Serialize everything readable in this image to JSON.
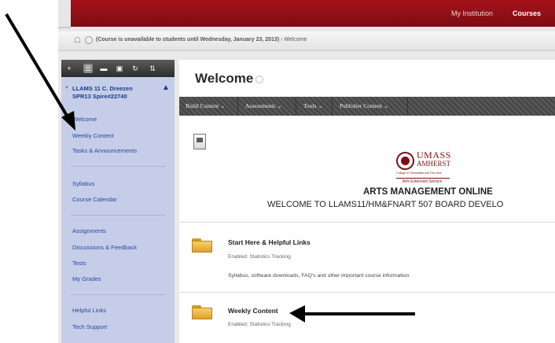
{
  "topnav": {
    "items": [
      {
        "label": "My Institution",
        "active": false
      },
      {
        "label": "Courses",
        "active": true
      }
    ]
  },
  "breadcrumb": {
    "home_icon": "home-icon",
    "notice": "(Course is unavailable to students until Wednesday, January 23, 2013)",
    "separator": "›",
    "current": "Welcome"
  },
  "sidebar": {
    "tool_icons": [
      "plus-icon",
      "list-view-icon",
      "folder-view-icon",
      "card-view-icon",
      "refresh-icon",
      "sort-icon"
    ],
    "course_title_line1": "LLAMS 11 C. Dreezen",
    "course_title_line2": "SPR13 Spire#22740",
    "items": [
      {
        "label": "Welcome"
      },
      {
        "label": "Weekly Content"
      },
      {
        "label": "Tasks & Announcements"
      },
      {
        "label": "Syllabus"
      },
      {
        "label": "Course Calendar"
      },
      {
        "label": "Assignments"
      },
      {
        "label": "Discussions & Feedback"
      },
      {
        "label": "Tests"
      },
      {
        "label": "My Grades"
      },
      {
        "label": "Helpful Links"
      },
      {
        "label": "Tech Support"
      }
    ]
  },
  "page": {
    "title": "Welcome",
    "actions": [
      {
        "label": "Build Content ⌄"
      },
      {
        "label": "Assessments ⌄"
      },
      {
        "label": "Tools ⌄"
      },
      {
        "label": "Publisher Content ⌄"
      }
    ],
    "banner": {
      "logo_name": "UMASS",
      "logo_sub": "AMHERST",
      "logo_fine": "College of Humanities and Fine Arts",
      "logo_ext": "Arts Extension Service",
      "heading": "ARTS MANAGEMENT ONLINE",
      "welcome": "WELCOME TO LLAMS11/HM&FNART 507 BOARD DEVELO"
    },
    "items": [
      {
        "title": "Start Here & Helpful Links",
        "meta": "Enabled:  Statistics Tracking",
        "description": "Syllabus, software downloads, FAQ's and other important course information."
      },
      {
        "title": "Weekly Content",
        "meta": "Enabled:  Statistics Tracking",
        "description": ""
      }
    ]
  },
  "colors": {
    "brand_red": "#8f1019",
    "sidebar_bg": "#c5cde8",
    "link_blue": "#2848a0",
    "annotation_arrow": "#000000"
  }
}
